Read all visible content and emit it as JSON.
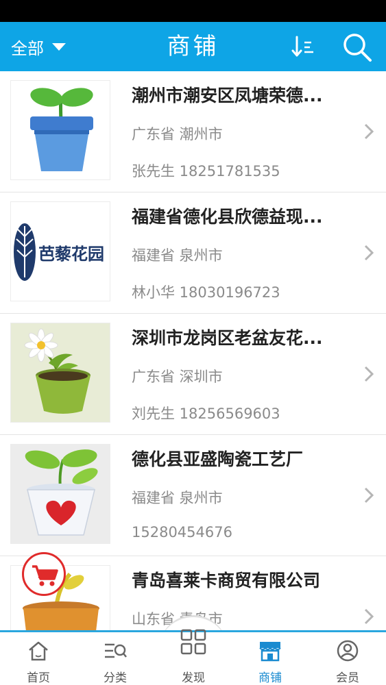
{
  "header": {
    "filter_label": "全部",
    "title": "商铺",
    "background_color": "#0ea5e6",
    "sort_icon": "sort-icon",
    "search_icon": "search-icon"
  },
  "shops": [
    {
      "name": "潮州市潮安区凤塘荣德...",
      "region": "广东省 潮州市",
      "contact": "张先生 18251781535",
      "image": "sprout-pot-image"
    },
    {
      "name": "福建省德化县欣德益现...",
      "region": "福建省 泉州市",
      "contact": "林小华 18030196723",
      "image": "logo-image"
    },
    {
      "name": "深圳市龙岗区老盆友花...",
      "region": "广东省 深圳市",
      "contact": "刘先生 18256569603",
      "image": "daisy-pot-image"
    },
    {
      "name": "德化县亚盛陶瓷工艺厂",
      "region": "福建省 泉州市",
      "contact": " 15280454676",
      "image": "heart-pot-image"
    },
    {
      "name": "青岛喜莱卡商贸有限公司",
      "region": "山东省 青岛市",
      "contact": "",
      "image": "plant-pot-image"
    }
  ],
  "logo_text": "芭藜花园",
  "tabbar": {
    "accent_color": "#1a8bd0",
    "tabs": [
      {
        "label": "首页",
        "icon": "home-icon"
      },
      {
        "label": "分类",
        "icon": "category-icon"
      },
      {
        "label": "发现",
        "icon": "discover-icon"
      },
      {
        "label": "商铺",
        "icon": "shop-icon",
        "active": true
      },
      {
        "label": "会员",
        "icon": "member-icon"
      }
    ]
  }
}
